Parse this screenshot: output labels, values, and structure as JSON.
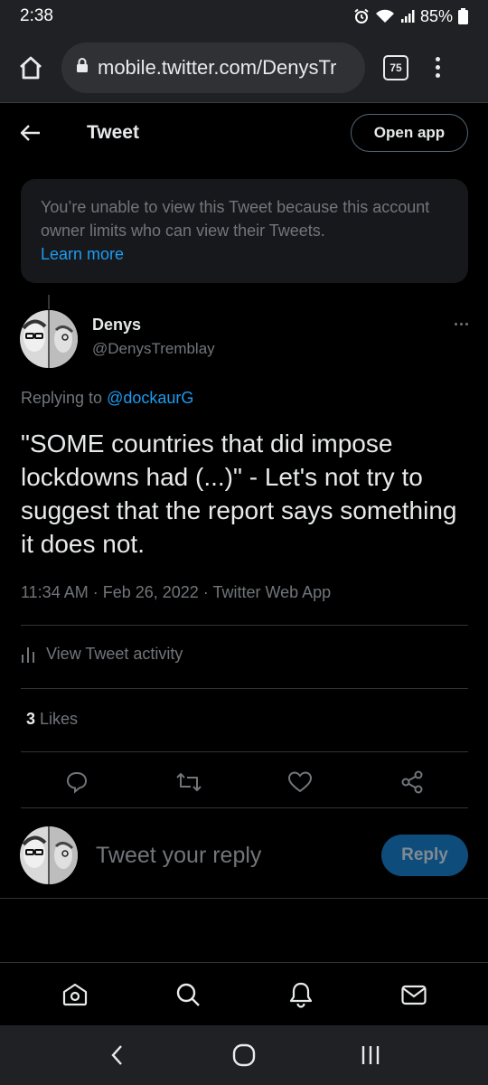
{
  "status_bar": {
    "time": "2:38",
    "battery": "85%"
  },
  "browser": {
    "url": "mobile.twitter.com/DenysTr",
    "tab_count": "75"
  },
  "header": {
    "title": "Tweet",
    "open_app_label": "Open app"
  },
  "notice": {
    "message": "You’re unable to view this Tweet because this account owner limits who can view their Tweets.",
    "link_label": "Learn more"
  },
  "tweet": {
    "author_name": "Denys",
    "author_handle": "@DenysTremblay",
    "replying_prefix": "Replying to",
    "replying_handle": "@dockaurG",
    "text": "\"SOME countries that did impose lockdowns had (...)\" - Let's not try to suggest that the report says something it does not.",
    "meta": "11:34 AM · Feb 26, 2022 · Twitter Web App",
    "activity_label": "View Tweet activity",
    "likes_count": "3",
    "likes_label": "Likes"
  },
  "composer": {
    "placeholder": "Tweet your reply",
    "reply_label": "Reply"
  },
  "colors": {
    "accent": "#1d9bf0",
    "background": "#000000",
    "muted": "#71767b"
  },
  "icons": {
    "status": [
      "alarm-icon",
      "wifi-icon",
      "signal-icon",
      "battery-icon"
    ],
    "actions": [
      "reply-icon",
      "retweet-icon",
      "like-icon",
      "share-icon"
    ],
    "nav": [
      "home-icon",
      "search-icon",
      "notifications-icon",
      "messages-icon"
    ],
    "android": [
      "back-icon",
      "home-icon",
      "recents-icon"
    ]
  }
}
